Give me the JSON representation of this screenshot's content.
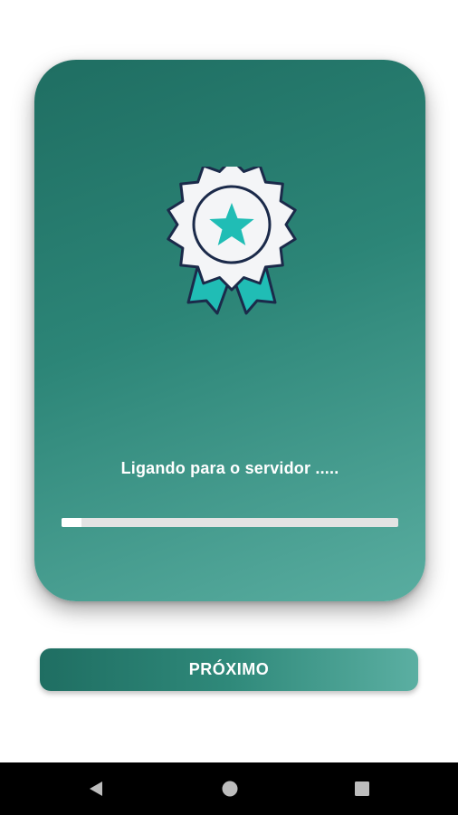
{
  "card": {
    "status_text": "Ligando para o servidor .....",
    "progress_fraction": 0.06
  },
  "icons": {
    "badge": "award-ribbon-icon",
    "back": "back-triangle-icon",
    "home": "home-circle-icon",
    "recent": "recent-apps-square-icon"
  },
  "button": {
    "label": "PRÓXIMO"
  },
  "colors": {
    "card_gradient_start": "#1f6e62",
    "card_gradient_end": "#59ada0",
    "badge_star": "#20bdb5",
    "badge_outline": "#1b2a4a",
    "progress_track": "#e3e3e3",
    "progress_fill": "#ffffff",
    "navbar": "#000000"
  }
}
